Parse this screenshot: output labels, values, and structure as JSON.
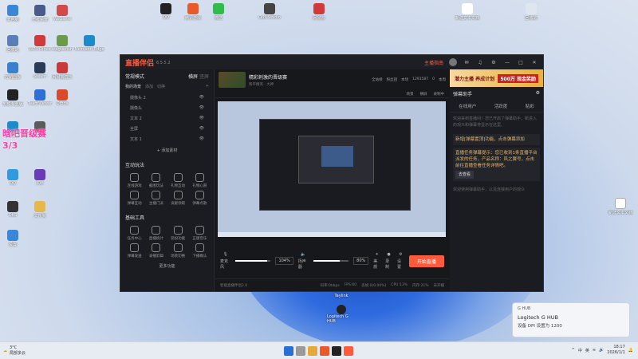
{
  "desktop": {
    "icons_left": [
      {
        "label": "此电脑",
        "color": "#3a86d8"
      },
      {
        "label": "王者荣耀",
        "color": "#4a5a8a"
      },
      {
        "label": "WeGame",
        "color": "#d24a4a"
      },
      {
        "label": "回收站",
        "color": "#5a7fb8"
      },
      {
        "label": "WPS Office",
        "color": "#cf3b3b"
      },
      {
        "label": "leaguefish",
        "color": "#6a9a4a"
      },
      {
        "label": "Microsoft Edge",
        "color": "#1c8acb"
      },
      {
        "label": "控制面板",
        "color": "#3b7fd0"
      },
      {
        "label": "Steam",
        "color": "#2a3b55"
      },
      {
        "label": "网易云音乐",
        "color": "#c93a3a"
      },
      {
        "label": "剪映专业版",
        "color": "#222"
      },
      {
        "label": "TeamViewer",
        "color": "#2d6fd4"
      },
      {
        "label": "Office",
        "color": "#d84a2a"
      },
      {
        "label": "Edge",
        "color": "#1c8acb"
      },
      {
        "label": "Clash",
        "color": "#5a5a5a"
      },
      {
        "label": "QQ",
        "color": "#2f9ae0"
      },
      {
        "label": "IDE",
        "color": "#6a3bb8"
      },
      {
        "label": "OBS",
        "color": "#333"
      },
      {
        "label": "文件夹",
        "color": "#e6b84a"
      },
      {
        "label": "设置",
        "color": "#3a86d8"
      }
    ],
    "icons_top": [
      {
        "label": "QQ",
        "color": "#222"
      },
      {
        "label": "腾讯游戏",
        "color": "#e85a2a"
      },
      {
        "label": "微信",
        "color": "#2fbd4a"
      },
      {
        "label": "OBS Studio",
        "color": "#444"
      },
      {
        "label": "网易云",
        "color": "#d23a3a"
      },
      {
        "label": "新建文本文档",
        "color": "#ffffff"
      },
      {
        "label": "回收站",
        "color": "#dfe6ef"
      }
    ],
    "pink_overlay": "晗吧晋级赛\n3/3",
    "right_file": "新建文本文档",
    "mid_icon": "Logitech G HUB",
    "mid_label_top": "Taylink"
  },
  "app": {
    "logo": "直播伴侣",
    "version": "6.5.5.2",
    "guide": "主播指南",
    "title_icons": [
      "消息",
      "设置",
      "帮助",
      "—",
      "□",
      "✕"
    ],
    "mode_label": "常规模式",
    "mode_opts": [
      "横屏",
      "竖屏"
    ],
    "scene_tabs": [
      "我的场景",
      "添加",
      "切换",
      "场景设置"
    ],
    "scenes": [
      {
        "name": "摄像头 2"
      },
      {
        "name": "摄像头"
      },
      {
        "name": "文本 2"
      },
      {
        "name": "全屏"
      },
      {
        "name": "文本 1"
      }
    ],
    "add_source": "+ 添加素材",
    "interactive_title": "互动玩法",
    "interactive": [
      "连线游戏",
      "截图玩法",
      "礼物互动",
      "礼物心愿",
      "弹幕互动",
      "主播门派",
      "贡献领取",
      "弹幕点歌"
    ],
    "tools_title": "基础工具",
    "tools": [
      "任务中心",
      "直播统计",
      "装扮功能",
      "正版音乐",
      "弹幕发送",
      "录播剪辑",
      "场景切换",
      "下播确认"
    ],
    "more": "更多功能",
    "room": {
      "title": "精彩刺激的晋级赛",
      "sub": "和平精英 · 大神",
      "stats": [
        "全站榜",
        "粉丝团",
        "本场",
        "1293587",
        "0",
        "本周"
      ]
    },
    "preview_bar": [
      "场景",
      "横屏",
      "录制中"
    ],
    "controls": {
      "mic_label": "麦克风",
      "mic_pct": "104%",
      "speaker_label": "扬声器",
      "speaker_pct": "80%",
      "beauty": "美颜",
      "record": "录制",
      "settings": "设置",
      "golive": "开始直播"
    },
    "status": [
      "码率:0kbps",
      "FPS:60",
      "丢帧:0(0.00%)",
      "CPU:13%",
      "内存:21%",
      "未开播"
    ],
    "status_left": "智能直播伴侣2.0",
    "right": {
      "banner": "潜力主播 养成计划",
      "banner2": "500万 现金奖励",
      "title": "弹幕助手",
      "tabs": [
        "在线用户",
        "活跃度",
        "贴彩"
      ],
      "hint1": "欢迎来到直播间！您已开启了弹幕助手，新进入的观众和弹幕将显示在这里。",
      "card1": "新增[弹幕置顶]功能，点击弹幕添加",
      "card2": "直播任务弹幕提示：您已收到1条直播平台派发的任务，产品名称：风之翼号，点击前往直播查看任务详情吧。",
      "btn": "去查看",
      "hint2": "欢迎使用弹幕助手，以及连接用户的观众"
    }
  },
  "taskbar": {
    "weather_temp": "3°C",
    "weather_desc": "局部多云",
    "tray": [
      "^",
      "中",
      "英"
    ],
    "time": "18:17",
    "date": "2026/1/1"
  },
  "toast": {
    "app": "G HUB",
    "title": "Logitech G HUB",
    "body": "设备 DPI 设置为 1200"
  }
}
